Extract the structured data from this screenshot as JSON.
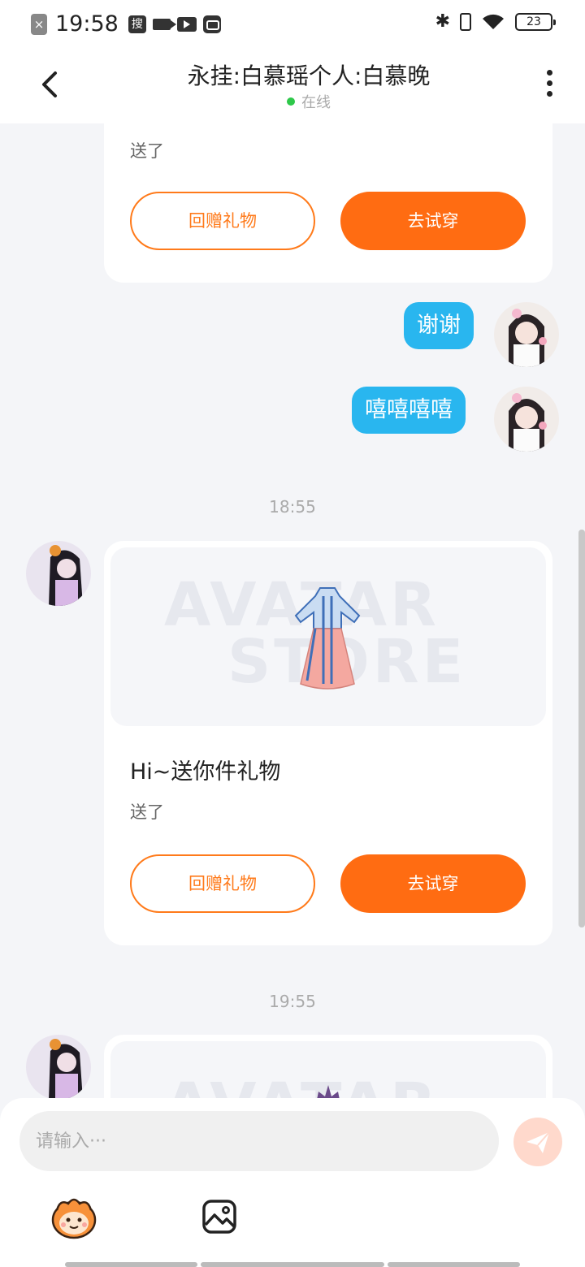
{
  "status_bar": {
    "time": "19:58",
    "sou_label": "搜",
    "battery": "23"
  },
  "header": {
    "title": "永挂:白慕瑶个人:白慕晚",
    "status": "在线"
  },
  "messages": {
    "card_top": {
      "sent_text": "送了",
      "reply_label": "回赠礼物",
      "try_label": "去试穿"
    },
    "bubble_1": "谢谢",
    "bubble_2": "嘻嘻嘻嘻",
    "time_1": "18:55",
    "card_mid": {
      "watermark_1": "AVATAR",
      "watermark_2": "STORE",
      "title": "Hi~送你件礼物",
      "sent_text": "送了",
      "reply_label": "回赠礼物",
      "try_label": "去试穿"
    },
    "time_2": "19:55",
    "card_bottom": {
      "watermark_1": "AVATAR"
    }
  },
  "input": {
    "placeholder": "请输入···"
  },
  "colors": {
    "accent_orange": "#ff6c12",
    "bubble_blue": "#29b6ef",
    "online_green": "#2ec84a"
  },
  "icons": [
    "back-arrow-icon",
    "more-vertical-icon",
    "send-icon",
    "emoji-face-icon",
    "image-icon"
  ]
}
